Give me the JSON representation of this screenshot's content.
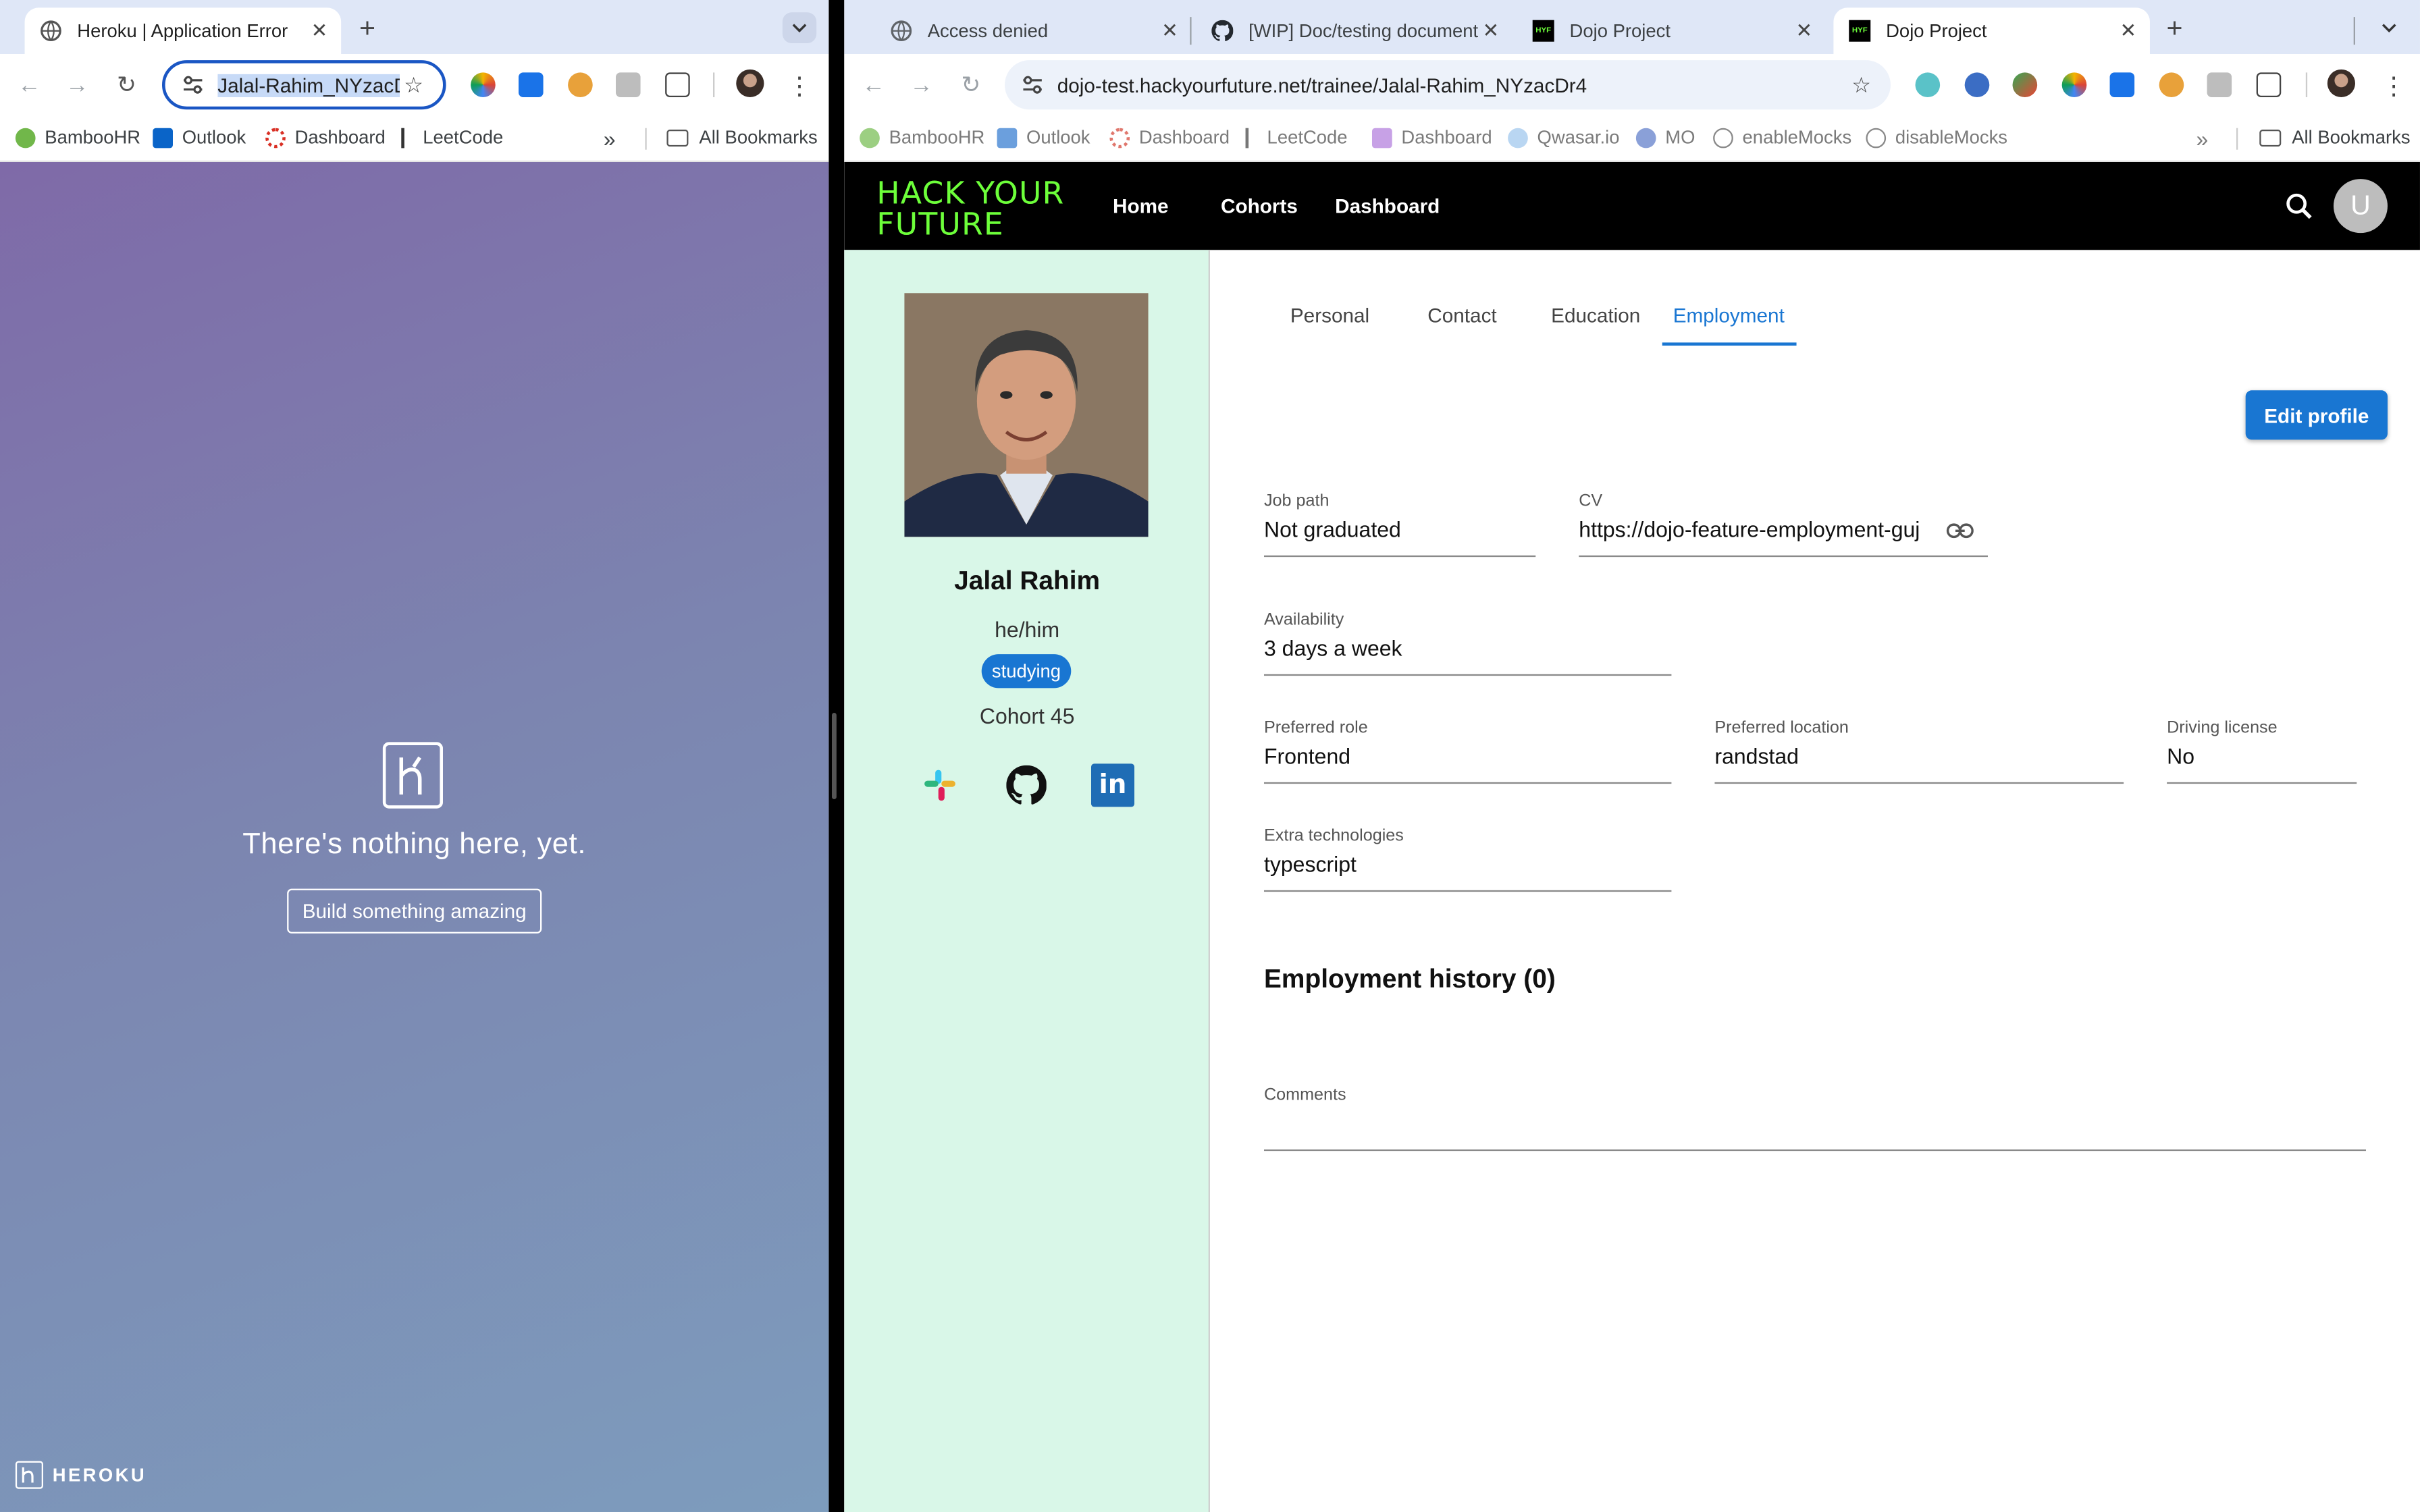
{
  "left_window": {
    "tabs": [
      {
        "title": "Heroku | Application Error"
      }
    ],
    "new_tab_label": "+",
    "tab_menu_label": "⌄",
    "address": "Jalal-Rahim_NYzacD",
    "bookmarks": [
      "BambooHR",
      "Outlook",
      "Dashboard",
      "LeetCode"
    ],
    "bookmarks_overflow": "»",
    "all_bookmarks": "All Bookmarks",
    "page": {
      "message": "There's nothing here, yet.",
      "button": "Build something amazing",
      "footer": "HEROKU",
      "background_colors": [
        "#7f6aa8",
        "#7d9cbd"
      ]
    }
  },
  "right_window": {
    "tabs": [
      {
        "title": "Access denied"
      },
      {
        "title": "[WIP] Doc/testing document"
      },
      {
        "title": "Dojo Project"
      },
      {
        "title": "Dojo Project"
      }
    ],
    "new_tab_label": "+",
    "tab_menu_label": "⌄",
    "address": "dojo-test.hackyourfuture.net/trainee/Jalal-Rahim_NYzacDr4",
    "bookmarks": [
      "BambooHR",
      "Outlook",
      "Dashboard",
      "LeetCode",
      "Dashboard",
      "Qwasar.io",
      "MO",
      "enableMocks",
      "disableMocks"
    ],
    "bookmarks_overflow": "»",
    "all_bookmarks": "All Bookmarks"
  },
  "dojo": {
    "logo_line1": "HACK YOUR",
    "logo_line2": "FUTURE",
    "nav": [
      "Home",
      "Cohorts",
      "Dashboard"
    ],
    "avatar_initial": "U",
    "profile": {
      "name": "Jalal Rahim",
      "pronouns": "he/him",
      "status": "studying",
      "cohort": "Cohort 45"
    },
    "tabs": [
      "Personal",
      "Contact",
      "Education",
      "Employment"
    ],
    "active_tab": "Employment",
    "edit_button": "Edit profile",
    "fields": {
      "job_path": {
        "label": "Job path",
        "value": "Not graduated"
      },
      "cv": {
        "label": "CV",
        "value": "https://dojo-feature-employment-guj"
      },
      "availability": {
        "label": "Availability",
        "value": "3 days a week"
      },
      "preferred_role": {
        "label": "Preferred role",
        "value": "Frontend"
      },
      "preferred_location": {
        "label": "Preferred location",
        "value": "randstad"
      },
      "driving_license": {
        "label": "Driving license",
        "value": "No"
      },
      "extra_technologies": {
        "label": "Extra technologies",
        "value": "typescript"
      },
      "comments": {
        "label": "Comments",
        "value": ""
      }
    },
    "employment_history_title": "Employment history (0)",
    "colors": {
      "accent": "#1976d2",
      "logo": "#6dff3a",
      "sidebar": "#d9f7e8",
      "header": "#000000"
    }
  }
}
